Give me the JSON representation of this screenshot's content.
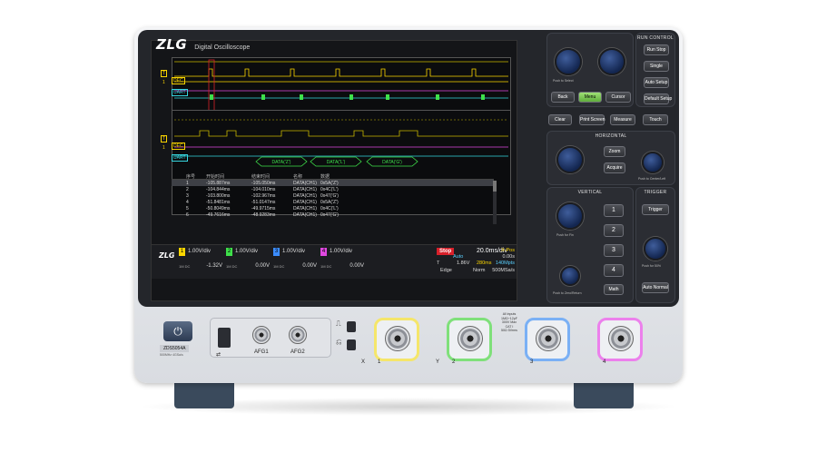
{
  "brand": {
    "logo": "ZLG",
    "product_name": "Digital Oscilloscope",
    "model": "ZDS5054A",
    "model_specs": [
      "500MHz",
      "4GSa/s"
    ]
  },
  "traces": {
    "top_labels": [
      "T",
      "1",
      "DEC",
      "UART"
    ],
    "mid_labels": [
      "T",
      "1",
      "DEC",
      "UART"
    ],
    "decode_bubbles": [
      "DATA('Z')",
      "DATA('L')",
      "DATA('G')"
    ]
  },
  "table": {
    "headers": [
      "",
      "序号",
      "开始时间",
      "结束时间",
      "名称",
      "数据"
    ],
    "rows": [
      [
        "",
        "1",
        "-105.887ms",
        "-105.050ms",
        "DATA(CH1)",
        "0x5A('Z')"
      ],
      [
        "",
        "2",
        "-104.844ms",
        "-104.010ms",
        "DATA(CH1)",
        "0x4C('L')"
      ],
      [
        "",
        "3",
        "-103.800ms",
        "-102.967ms",
        "DATA(CH1)",
        "0x47('G')"
      ],
      [
        "",
        "4",
        "-51.8481ms",
        "-51.0147ms",
        "DATA(CH1)",
        "0x5A('Z')"
      ],
      [
        "",
        "5",
        "-50.8049ms",
        "-49.9715ms",
        "DATA(CH1)",
        "0x4C('L')"
      ],
      [
        "",
        "6",
        "-49.7616ms",
        "-48.9283ms",
        "DATA(CH1)",
        "0x47('G')"
      ]
    ]
  },
  "channels": [
    {
      "num": "1",
      "vdiv": "1.00V/div",
      "offset": "-1.32V",
      "coupling": "1M DC",
      "color": "#fcd600"
    },
    {
      "num": "2",
      "vdiv": "1.00V/div",
      "offset": "0.00V",
      "coupling": "1M DC",
      "color": "#3ee04a"
    },
    {
      "num": "3",
      "vdiv": "1.00V/div",
      "offset": "0.00V",
      "coupling": "1M DC",
      "color": "#3b8cff"
    },
    {
      "num": "4",
      "vdiv": "1.00V/div",
      "offset": "0.00V",
      "coupling": "1M DC",
      "color": "#e048e0"
    }
  ],
  "status": {
    "run_state": "Stop",
    "trig_mode": "Auto",
    "timebase": "20.0ms/div",
    "x_pos_label": "X-Pos",
    "x_pos": "0.00s",
    "trig_label": "T",
    "trig_level": "1.86V",
    "record_length": "280ms",
    "memory": "140Mpts",
    "trig_type": "Edge",
    "acq": "Norm",
    "sample_rate": "500MSa/s"
  },
  "panel": {
    "run_control": {
      "title": "RUN CONTROL",
      "buttons": [
        "Run Stop",
        "Single",
        "Auto Setup",
        "Default Setup"
      ]
    },
    "nav": {
      "knob_hint": "Push to Select",
      "buttons": [
        "Back",
        "Menu",
        "Cursor"
      ]
    },
    "util": {
      "buttons": [
        "Clear",
        "Print Screen",
        "Measure",
        "Touch"
      ]
    },
    "horizontal": {
      "title": "HORIZONTAL",
      "buttons": [
        "Zoom",
        "Acquire"
      ],
      "hint": "Push to Center/Left"
    },
    "vertical": {
      "title": "VERTICAL",
      "buttons": [
        "1",
        "2",
        "3",
        "4",
        "Math"
      ],
      "hint_top": "Push for Fin",
      "hint_bottom": "Push to Zero/Return"
    },
    "trigger": {
      "title": "TRIGGER",
      "buttons": [
        "Trigger",
        "Auto Normal"
      ],
      "hint": "Push for 50%"
    }
  },
  "front": {
    "ports": [
      "AFG1",
      "AFG2"
    ],
    "input_labels": [
      "X",
      "1",
      "Y",
      "2",
      "3",
      "4"
    ],
    "warning": [
      "All inputs",
      "1MΩ~12pF",
      "300V Max",
      "CAT I",
      "50Ω 5Vrms"
    ]
  },
  "colors": {
    "ch1": "#fcd600",
    "ch2": "#3ee04a",
    "ch3": "#3b8cff",
    "ch4": "#e048e0",
    "uart": "#36d6e0",
    "dec": "#fcd600",
    "stop": "#d8202a",
    "menu_active": "#7fcf55"
  }
}
